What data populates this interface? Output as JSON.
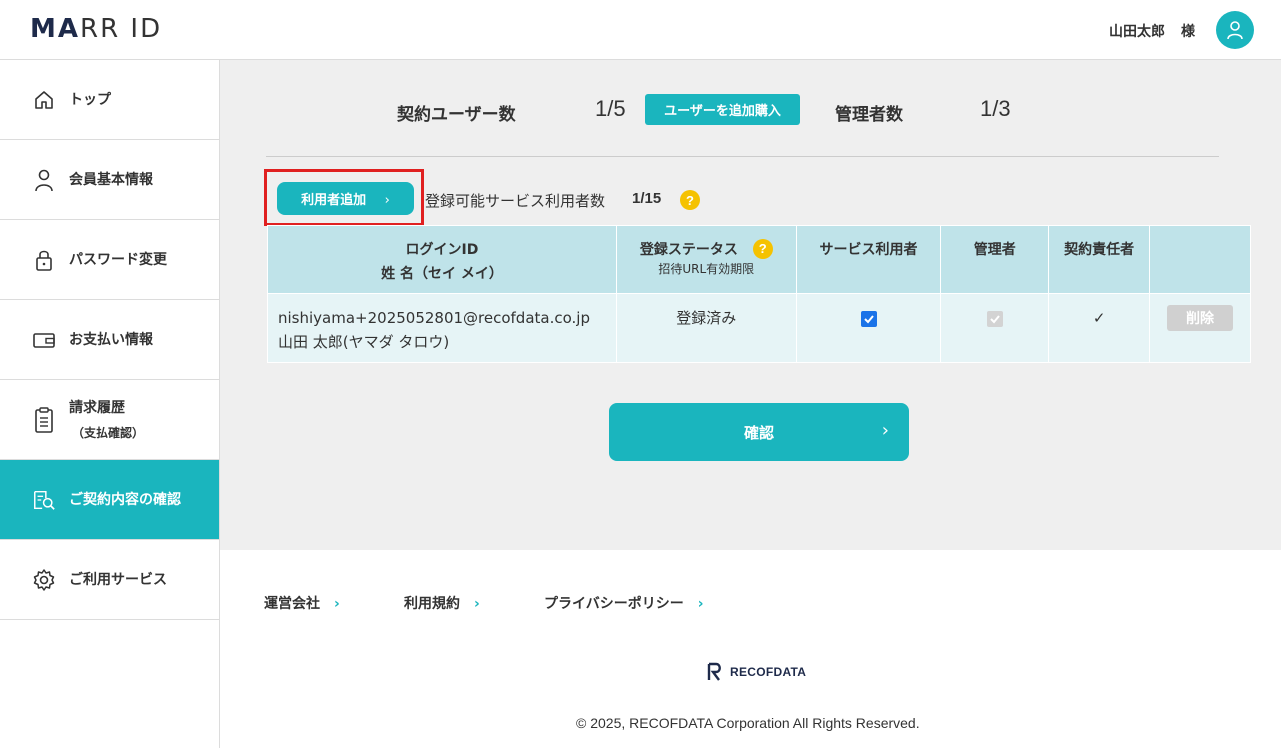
{
  "header": {
    "logo_main": "MA",
    "logo_rest": "RR ID",
    "user_name": "山田太郎",
    "user_honorific": "様"
  },
  "sidebar": {
    "items": [
      {
        "label": "トップ",
        "icon": "home-icon"
      },
      {
        "label": "会員基本情報",
        "icon": "person-icon"
      },
      {
        "label": "パスワード変更",
        "icon": "lock-icon"
      },
      {
        "label": "お支払い情報",
        "icon": "wallet-icon"
      },
      {
        "label": "請求履歴",
        "sub_label": "（支払確認）",
        "icon": "clipboard-icon"
      },
      {
        "label": "ご契約内容の確認",
        "icon": "contract-search-icon",
        "active": true
      },
      {
        "label": "ご利用サービス",
        "icon": "gear-icon"
      }
    ]
  },
  "summary": {
    "contract_users_label": "契約ユーザー数",
    "contract_users_value": "1/5",
    "add_purchase_label": "ユーザーを追加購入",
    "admins_label": "管理者数",
    "admins_value": "1/3"
  },
  "actions": {
    "add_user_label": "利用者追加",
    "service_count_label": "登録可能サービス利用者数",
    "service_count_value": "1/15",
    "help_glyph": "?"
  },
  "table": {
    "headers": {
      "login_id": "ログインID",
      "name": "姓 名（セイ メイ）",
      "status": "登録ステータス",
      "status_sub": "招待URL有効期限",
      "service_user": "サービス利用者",
      "admin": "管理者",
      "contract_owner": "契約責任者"
    },
    "rows": [
      {
        "email": "nishiyama+2025052801@recofdata.co.jp",
        "name": "山田 太郎(ヤマダ タロウ)",
        "status": "登録済み",
        "service_user": true,
        "admin": true,
        "contract_owner": "✓",
        "delete_label": "削除"
      }
    ]
  },
  "confirm": {
    "label": "確認",
    "arrow": "›"
  },
  "footer": {
    "links": [
      "運営会社",
      "利用規約",
      "プライバシーポリシー"
    ],
    "chevron": "›",
    "brand": "RECOFDATA",
    "copyright": "© 2025, RECOFDATA Corporation All Rights Reserved."
  },
  "colors": {
    "accent": "#1ab5be",
    "header_bg": "#bfe3e9",
    "row_bg": "#e6f4f6",
    "highlight": "#e02020",
    "help": "#f5c200"
  }
}
